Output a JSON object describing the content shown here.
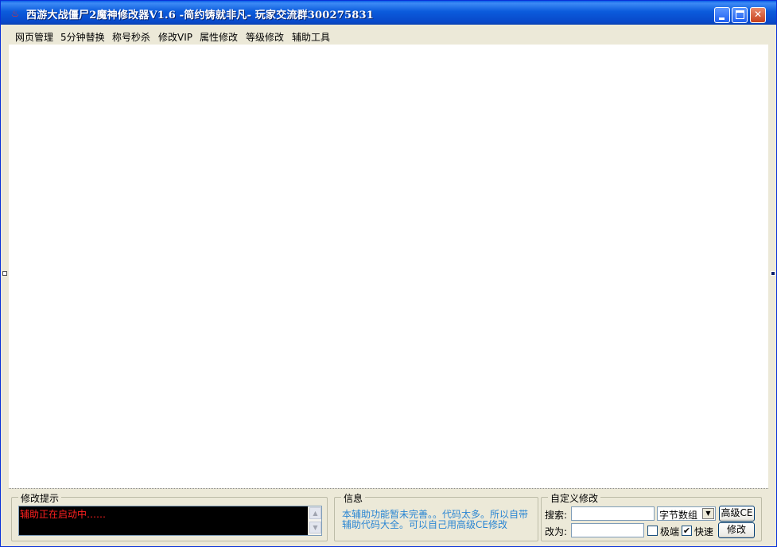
{
  "window": {
    "title": "西游大战僵尸2魔神修改器V1.6 -简约铸就非凡-   玩家交流群300275831",
    "app_icon_glyph": "♨"
  },
  "menu": {
    "items": [
      "网页管理",
      "5分钟替换",
      "称号秒杀",
      "修改VIP",
      "属性修改",
      "等级修改",
      "辅助工具"
    ]
  },
  "hint_group": {
    "title": "修改提示",
    "message": "辅助正在启动中……"
  },
  "info_group": {
    "title": "信息",
    "line1": "本辅助功能暂未完善。。代码太多。所以自带",
    "line2": "辅助代码大全。可以自己用高级CE修改"
  },
  "custom_group": {
    "title": "自定义修改",
    "search_label": "搜索:",
    "replace_label": "改为:",
    "search_value": "",
    "replace_value": "",
    "type_selected": "字节数组",
    "ce_button": "高级CE",
    "extreme_label": "极端",
    "extreme_checked": false,
    "fast_label": "快速",
    "fast_checked": true,
    "modify_button": "修改"
  },
  "colors": {
    "titlebar": "#0b5bdc",
    "hint_text": "#ff2020",
    "info_text": "#2b86d3",
    "hint_background": "#000000"
  }
}
